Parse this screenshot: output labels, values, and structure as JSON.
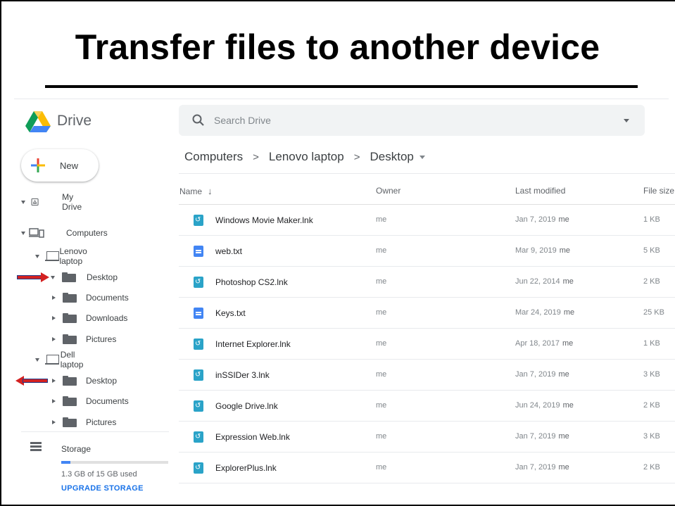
{
  "slide": {
    "title": "Transfer files to another device"
  },
  "header": {
    "app_name": "Drive",
    "search_placeholder": "Search Drive"
  },
  "nav": {
    "new_label": "New",
    "my_drive": "My Drive",
    "computers": "Computers",
    "lenovo": {
      "label": "Lenovo laptop",
      "folders": [
        "Desktop",
        "Documents",
        "Downloads",
        "Pictures"
      ]
    },
    "dell": {
      "label": "Dell laptop",
      "folders": [
        "Desktop",
        "Documents",
        "Pictures"
      ]
    },
    "storage": {
      "label": "Storage",
      "used_text": "1.3 GB of 15 GB used",
      "used_fraction": 0.087,
      "upgrade": "UPGRADE STORAGE"
    }
  },
  "breadcrumb": [
    "Computers",
    "Lenovo laptop",
    "Desktop"
  ],
  "table": {
    "columns": {
      "name": "Name",
      "owner": "Owner",
      "modified": "Last modified",
      "size": "File size"
    },
    "rows": [
      {
        "icon": "shortcut-icon",
        "name": "Windows Movie Maker.lnk",
        "owner": "me",
        "date": "Jan 7, 2019",
        "by": "me",
        "size": "1 KB"
      },
      {
        "icon": "text-doc-icon",
        "name": "web.txt",
        "owner": "me",
        "date": "Mar 9, 2019",
        "by": "me",
        "size": "5 KB"
      },
      {
        "icon": "shortcut-icon",
        "name": "Photoshop CS2.lnk",
        "owner": "me",
        "date": "Jun 22, 2014",
        "by": "me",
        "size": "2 KB"
      },
      {
        "icon": "text-doc-icon",
        "name": "Keys.txt",
        "owner": "me",
        "date": "Mar 24, 2019",
        "by": "me",
        "size": "25 KB"
      },
      {
        "icon": "shortcut-icon",
        "name": "Internet Explorer.lnk",
        "owner": "me",
        "date": "Apr 18, 2017",
        "by": "me",
        "size": "1 KB"
      },
      {
        "icon": "shortcut-icon",
        "name": "inSSIDer 3.lnk",
        "owner": "me",
        "date": "Jan 7, 2019",
        "by": "me",
        "size": "3 KB"
      },
      {
        "icon": "shortcut-icon",
        "name": "Google Drive.lnk",
        "owner": "me",
        "date": "Jun 24, 2019",
        "by": "me",
        "size": "2 KB"
      },
      {
        "icon": "shortcut-icon",
        "name": "Expression Web.lnk",
        "owner": "me",
        "date": "Jan 7, 2019",
        "by": "me",
        "size": "3 KB"
      },
      {
        "icon": "shortcut-icon",
        "name": "ExplorerPlus.lnk",
        "owner": "me",
        "date": "Jan 7, 2019",
        "by": "me",
        "size": "2 KB"
      }
    ]
  },
  "colors": {
    "accent": "#1a73e8",
    "arrow_red": "#d32121",
    "arrow_outline": "#1f3a8a"
  }
}
